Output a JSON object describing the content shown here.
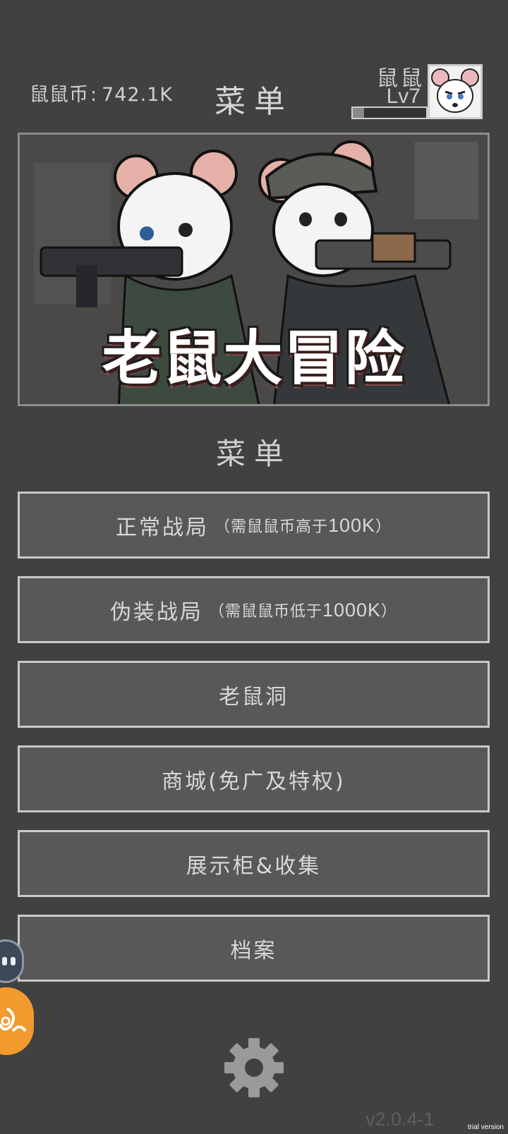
{
  "header": {
    "coins_label": "鼠鼠币",
    "coins_sep": ":",
    "coins_value": "742.1K",
    "title": "菜单"
  },
  "player": {
    "name": "鼠鼠",
    "level": "Lv7",
    "xp_fraction": 0.15
  },
  "banner": {
    "title": "老鼠大冒险"
  },
  "menu": {
    "heading": "菜单",
    "items": [
      {
        "label": "正常战局",
        "note_prefix": "（需鼠鼠币高于",
        "note_value": "100K",
        "note_suffix": "）"
      },
      {
        "label": "伪装战局",
        "note_prefix": "（需鼠鼠币低于",
        "note_value": "1000K",
        "note_suffix": "）"
      },
      {
        "label": "老鼠洞"
      },
      {
        "label": "商城(免广及特权)"
      },
      {
        "label": "展示柜&收集"
      },
      {
        "label": "档案"
      }
    ]
  },
  "footer": {
    "version": "v2.0.4-1",
    "trial": "trial version"
  },
  "icons": {
    "settings": "gear-icon",
    "side_1": "assistant-bubble-icon",
    "side_2": "orange-float-icon",
    "avatar": "mouse-avatar-icon"
  },
  "colors": {
    "background": "#414141",
    "button_fill": "#585858",
    "button_border": "#c9c9c9",
    "floating_orange": "#f29a2e"
  }
}
